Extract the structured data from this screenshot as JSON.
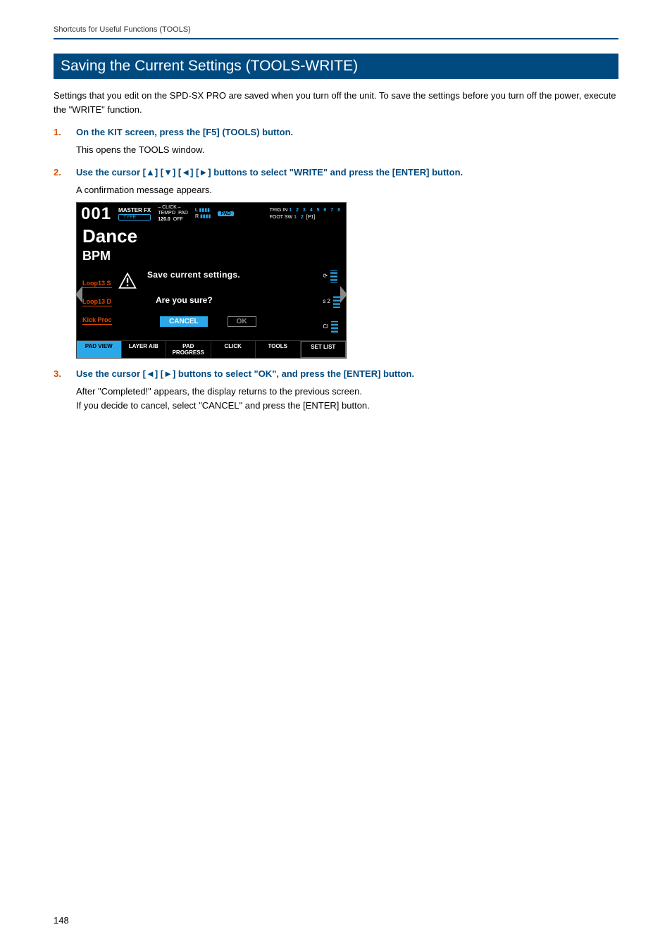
{
  "header": {
    "breadcrumb": "Shortcuts for Useful Functions (TOOLS)"
  },
  "title": "Saving the Current Settings (TOOLS-WRITE)",
  "intro": "Settings that you edit on the SPD-SX PRO are saved when you turn off the unit. To save the settings before you turn off the power, execute the \"WRITE\" function.",
  "steps": [
    {
      "num": "1.",
      "head": "On the KIT screen, press the [F5] (TOOLS) button.",
      "body": "This opens the TOOLS window."
    },
    {
      "num": "2.",
      "head": "Use the cursor [▲] [▼] [◄] [►] buttons to select \"WRITE\" and press the [ENTER] button.",
      "body": "A confirmation message appears."
    },
    {
      "num": "3.",
      "head": "Use the cursor [◄] [►] buttons to select \"OK\", and press the [ENTER] button.",
      "body": "After \"Completed!\" appears, the display returns to the previous screen.\nIf you decide to cancel, select \"CANCEL\" and press the [ENTER] button."
    }
  ],
  "device_screen": {
    "kit_num": "001",
    "master_fx": "MASTER FX",
    "type_btn": "TYPE",
    "click_label": "– CLICK –",
    "tempo_label": "TEMPO",
    "tempo_val": "120.0",
    "pad_label": "PAD",
    "pad_state": "OFF",
    "l_label": "L",
    "r_label": "R",
    "pad_badge": "PAD",
    "trigin_label": "TRIG IN",
    "trigin_nums": "1 2 3 4 5 6 7 8",
    "footsw_label": "FOOT SW",
    "footsw_nums_on": "1 2",
    "footsw_p": "[P1]",
    "kit_name": "Dance",
    "bpm_label": "BPM",
    "left_tags": [
      "Loop13 S",
      "Loop13 D",
      "Kick Proc"
    ],
    "right_bars": [
      "s 2",
      "Cl"
    ],
    "dialog_line1": "Save current settings.",
    "dialog_line2": "Are you sure?",
    "btn_cancel": "CANCEL",
    "btn_ok": "OK",
    "fkeys": [
      "PAD VIEW",
      "LAYER A/B",
      "PAD PROGRESS",
      "CLICK",
      "TOOLS",
      "SET LIST"
    ]
  },
  "page_number": "148"
}
